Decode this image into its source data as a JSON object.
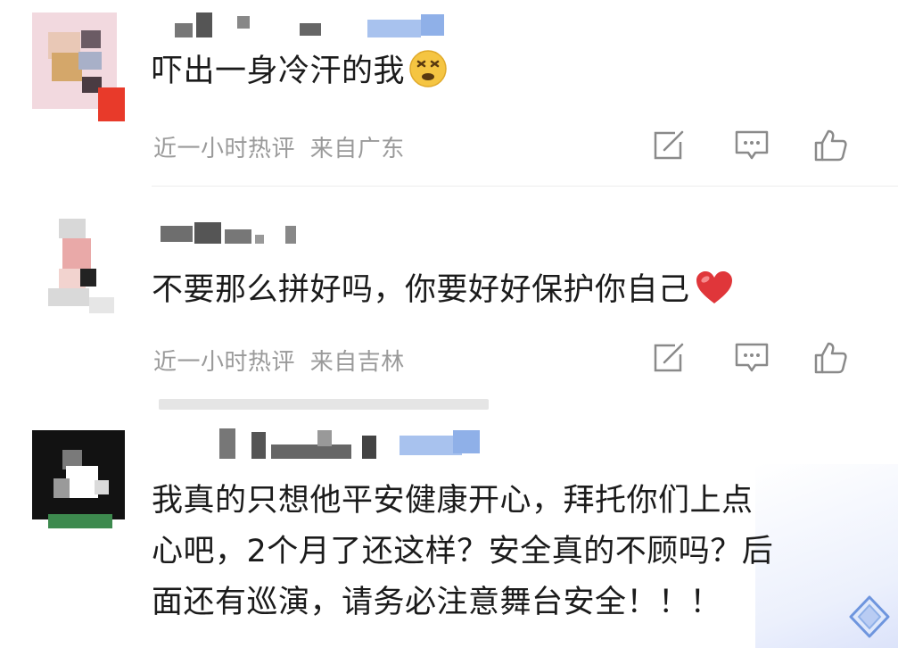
{
  "comments": [
    {
      "text": "吓出一身冷汗的我",
      "emoji": "dizzy-face-emoji",
      "time": "近一小时热评",
      "location": "来自广东"
    },
    {
      "text": "不要那么拼好吗，你要好好保护你自己",
      "emoji": "red-heart-emoji",
      "time": "近一小时热评",
      "location": "来自吉林"
    },
    {
      "text_lines": [
        "我真的只想他平安健康开心，拜托你们上点",
        "心吧，2个月了还这样？安全真的不顾吗？后",
        "面还有巡演，请务必注意舞台安全！！！"
      ]
    }
  ],
  "icons": {
    "edit": "edit-icon",
    "comment": "comment-icon",
    "like": "thumbs-up-icon",
    "badge": "diamond-badge-icon"
  },
  "colors": {
    "text": "#1b1b1b",
    "meta": "#9a9a9a",
    "icon": "#8a8a8a",
    "name_blue": "#8fb0e8",
    "heart": "#e0363a",
    "emoji_yellow": "#f5c542"
  }
}
